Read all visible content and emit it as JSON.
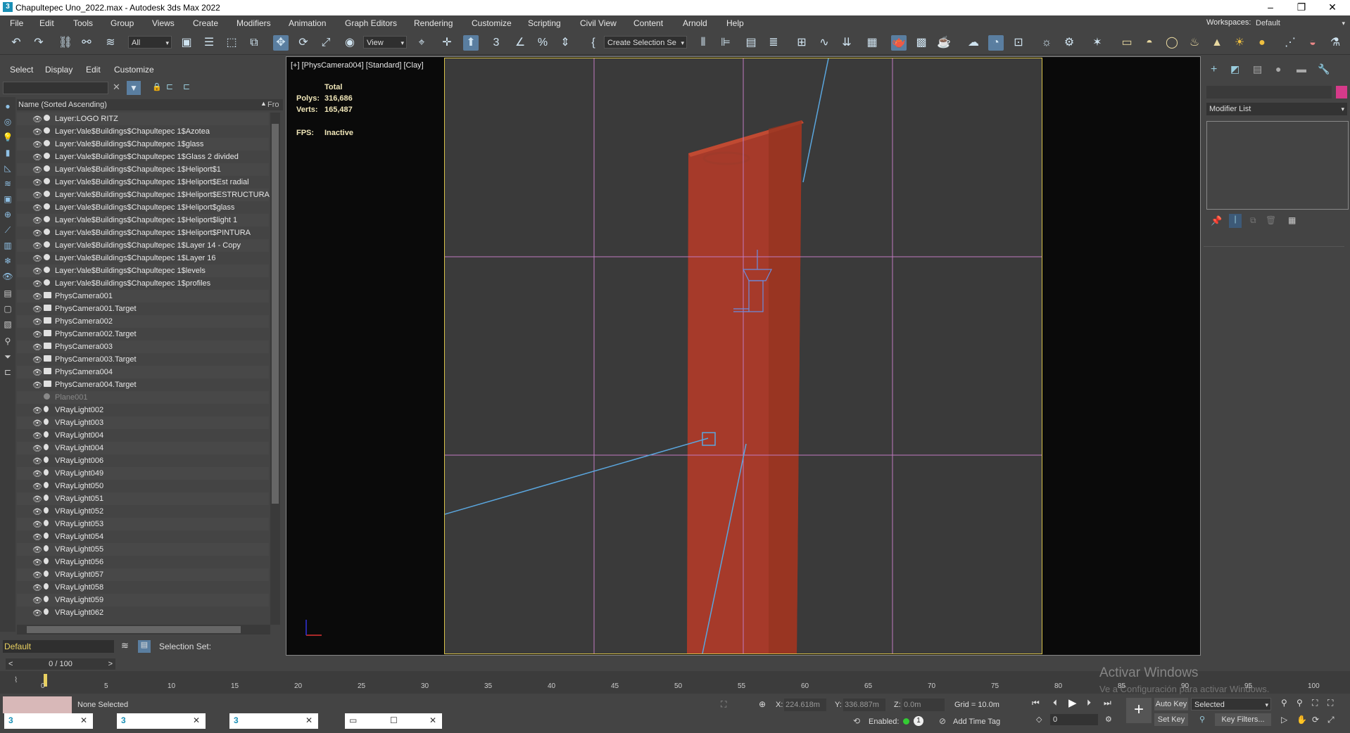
{
  "window": {
    "title": "Chapultepec Uno_2022.max - Autodesk 3ds Max 2022",
    "app_icon": "3",
    "minimize": "–",
    "maximize": "❐",
    "close": "✕"
  },
  "menu": [
    "File",
    "Edit",
    "Tools",
    "Group",
    "Views",
    "Create",
    "Modifiers",
    "Animation",
    "Graph Editors",
    "Rendering",
    "Customize",
    "Scripting",
    "Civil View",
    "Content",
    "Arnold",
    "Help"
  ],
  "workspaces": {
    "label": "Workspaces:",
    "value": "Default"
  },
  "toolbar": {
    "filter_value": "All",
    "refcoord_value": "View",
    "selection_set_value": "Create Selection Se"
  },
  "explorer": {
    "tabs": [
      "Select",
      "Display",
      "Edit",
      "Customize"
    ],
    "column_header": "Name (Sorted Ascending)",
    "column_header2": "Fro",
    "rows": [
      {
        "name": "Layer:LOGO RITZ",
        "icon": "dot"
      },
      {
        "name": "Layer:Vale$Buildings$Chapultepec 1$Azotea",
        "icon": "dot"
      },
      {
        "name": "Layer:Vale$Buildings$Chapultepec 1$glass",
        "icon": "dot"
      },
      {
        "name": "Layer:Vale$Buildings$Chapultepec 1$Glass 2 divided",
        "icon": "dot"
      },
      {
        "name": "Layer:Vale$Buildings$Chapultepec 1$Heliport$1",
        "icon": "dot"
      },
      {
        "name": "Layer:Vale$Buildings$Chapultepec 1$Heliport$Est radial",
        "icon": "dot"
      },
      {
        "name": "Layer:Vale$Buildings$Chapultepec 1$Heliport$ESTRUCTURA",
        "icon": "dot"
      },
      {
        "name": "Layer:Vale$Buildings$Chapultepec 1$Heliport$glass",
        "icon": "dot"
      },
      {
        "name": "Layer:Vale$Buildings$Chapultepec 1$Heliport$light 1",
        "icon": "dot"
      },
      {
        "name": "Layer:Vale$Buildings$Chapultepec 1$Heliport$PINTURA",
        "icon": "dot"
      },
      {
        "name": "Layer:Vale$Buildings$Chapultepec 1$Layer 14 - Copy",
        "icon": "dot"
      },
      {
        "name": "Layer:Vale$Buildings$Chapultepec 1$Layer 16",
        "icon": "dot"
      },
      {
        "name": "Layer:Vale$Buildings$Chapultepec 1$levels",
        "icon": "dot"
      },
      {
        "name": "Layer:Vale$Buildings$Chapultepec 1$profiles",
        "icon": "dot"
      },
      {
        "name": "PhysCamera001",
        "icon": "camera"
      },
      {
        "name": "PhysCamera001.Target",
        "icon": "camera"
      },
      {
        "name": "PhysCamera002",
        "icon": "camera"
      },
      {
        "name": "PhysCamera002.Target",
        "icon": "camera"
      },
      {
        "name": "PhysCamera003",
        "icon": "camera"
      },
      {
        "name": "PhysCamera003.Target",
        "icon": "camera"
      },
      {
        "name": "PhysCamera004",
        "icon": "camera"
      },
      {
        "name": "PhysCamera004.Target",
        "icon": "camera"
      },
      {
        "name": "Plane001",
        "icon": "dot",
        "dim": true
      },
      {
        "name": "VRayLight002",
        "icon": "light"
      },
      {
        "name": "VRayLight003",
        "icon": "light"
      },
      {
        "name": "VRayLight004",
        "icon": "light"
      },
      {
        "name": "VRayLight004",
        "icon": "light"
      },
      {
        "name": "VRayLight006",
        "icon": "light"
      },
      {
        "name": "VRayLight049",
        "icon": "light"
      },
      {
        "name": "VRayLight050",
        "icon": "light"
      },
      {
        "name": "VRayLight051",
        "icon": "light"
      },
      {
        "name": "VRayLight052",
        "icon": "light"
      },
      {
        "name": "VRayLight053",
        "icon": "light"
      },
      {
        "name": "VRayLight054",
        "icon": "light"
      },
      {
        "name": "VRayLight055",
        "icon": "light"
      },
      {
        "name": "VRayLight056",
        "icon": "light"
      },
      {
        "name": "VRayLight057",
        "icon": "light"
      },
      {
        "name": "VRayLight058",
        "icon": "light"
      },
      {
        "name": "VRayLight059",
        "icon": "light"
      },
      {
        "name": "VRayLight062",
        "icon": "light"
      }
    ],
    "layer_value": "Default",
    "selection_set_label": "Selection Set:"
  },
  "viewport": {
    "label": "[+] [PhysCamera004] [Standard] [Clay]",
    "stats_total": "Total",
    "polys_label": "Polys:",
    "polys_value": "316,686",
    "verts_label": "Verts:",
    "verts_value": "165,487",
    "fps_label": "FPS:",
    "fps_value": "Inactive",
    "building_color": "#b53a2a"
  },
  "command_panel": {
    "modifier_list": "Modifier List",
    "swatch_color": "#d63a8a"
  },
  "timeline": {
    "frame_counter": "0 / 100",
    "ticks": [
      "0",
      "5",
      "10",
      "15",
      "20",
      "25",
      "30",
      "35",
      "40",
      "45",
      "50",
      "55",
      "60",
      "65",
      "70",
      "75",
      "80",
      "85",
      "90",
      "95",
      "100"
    ]
  },
  "status": {
    "none_selected": "None Selected",
    "x_label": "X:",
    "x_value": "224.618m",
    "y_label": "Y:",
    "y_value": "336.887m",
    "z_label": "Z:",
    "z_value": "0.0m",
    "grid": "Grid = 10.0m",
    "enabled_label": "Enabled:",
    "add_time_tag": "Add Time Tag",
    "auto_key": "Auto Key",
    "set_key": "Set Key",
    "key_mode_value": "Selected",
    "key_filters": "Key Filters...",
    "frame_value": "0",
    "watermark_title": "Activar Windows",
    "watermark_sub": "Ve a Configuración para activar Windows."
  }
}
